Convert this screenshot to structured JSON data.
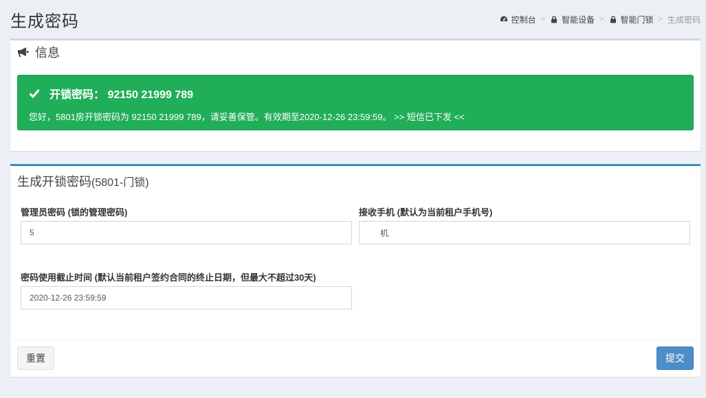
{
  "page": {
    "title": "生成密码"
  },
  "breadcrumb": {
    "items": [
      {
        "label": "控制台",
        "icon": "dashboard-icon"
      },
      {
        "label": "智能设备",
        "icon": "lock-icon"
      },
      {
        "label": "智能门锁",
        "icon": "lock-icon"
      }
    ],
    "current": "生成密码"
  },
  "info_box": {
    "title": "信息",
    "icon": "bullhorn-icon",
    "alert": {
      "title": "开锁密码：  92150 21999 789",
      "message": "您好，5801房开锁密码为 92150 21999 789，请妥善保管。有效期至2020-12-26 23:59:59。 >> 短信已下发 <<",
      "color": "#21ae59"
    }
  },
  "form_box": {
    "title": "生成开锁密码",
    "subtitle": "(5801-门锁)",
    "accent": "#3c8dbc",
    "admin_password": {
      "label": "管理员密码 (锁的管理密码)",
      "value": "5"
    },
    "receiver_phone": {
      "label": "接收手机 (默认为当前租户手机号)",
      "value": "机"
    },
    "expire_time": {
      "label": "密码使用截止时间 (默认当前租户签约合同的终止日期，但最大不超过30天)",
      "value": "2020-12-26 23:59:59"
    },
    "reset_label": "重置",
    "submit_label": "提交"
  }
}
